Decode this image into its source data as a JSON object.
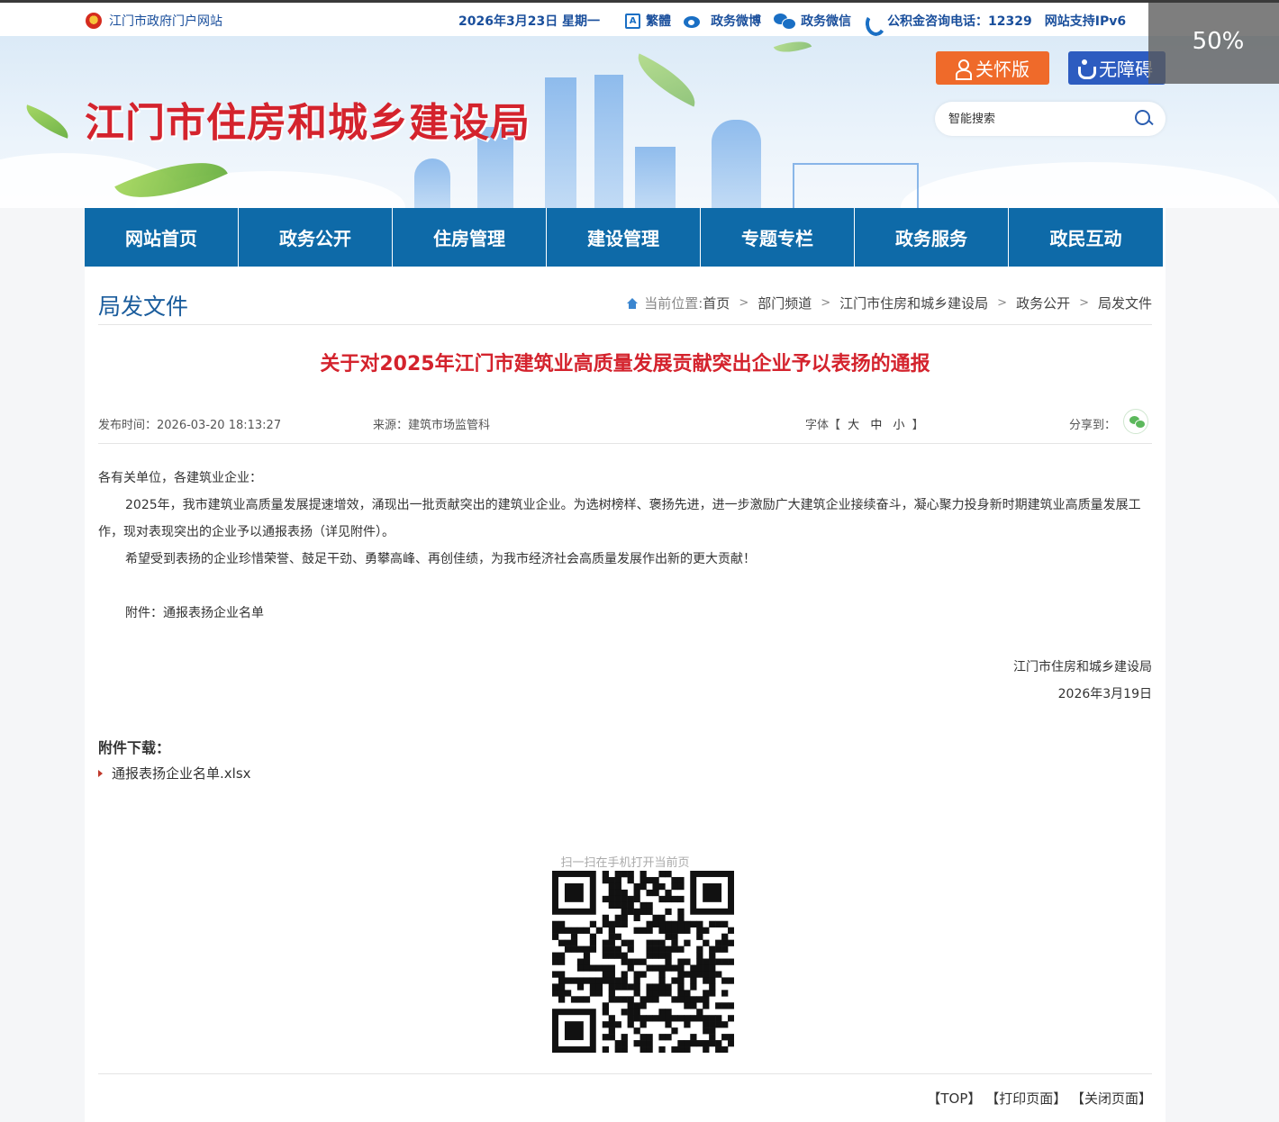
{
  "topbar": {
    "site_link": "江门市政府门户网站",
    "date": "2026年3月23日 星期一",
    "traditional": "繁體",
    "weibo": "政务微博",
    "wechat": "政务微信",
    "hotline": "公积金咨询电话：12329",
    "ipv6": "网站支持IPv6"
  },
  "zoom_level": "50%",
  "header": {
    "site_title": "江门市住房和城乡建设局",
    "care_button": "关怀版",
    "accessibility_button": "无障碍",
    "search_placeholder": "智能搜索"
  },
  "nav": {
    "items": [
      "网站首页",
      "政务公开",
      "住房管理",
      "建设管理",
      "专题专栏",
      "政务服务",
      "政民互动"
    ]
  },
  "column_title": "局发文件",
  "breadcrumb": {
    "label": "当前位置:",
    "items": [
      "首页",
      "部门频道",
      "江门市住房和城乡建设局",
      "政务公开",
      "局发文件"
    ]
  },
  "article": {
    "title": "关于对2025年江门市建筑业高质量发展贡献突出企业予以表扬的通报",
    "publish_label": "发布时间：",
    "publish_time": "2026-03-20 18:13:27",
    "source_label": "来源：",
    "source": "建筑市场监管科",
    "font_label": "字体【",
    "font_large": "大",
    "font_medium": "中",
    "font_small": "小",
    "font_close": "】",
    "share_label": "分享到：",
    "salutation": "各有关单位，各建筑业企业：",
    "paragraph1": "2025年，我市建筑业高质量发展提速增效，涌现出一批贡献突出的建筑业企业。为选树榜样、褒扬先进，进一步激励广大建筑企业接续奋斗，凝心聚力投身新时期建筑业高质量发展工作，现对表现突出的企业予以通报表扬（详见附件）。",
    "paragraph2": "希望受到表扬的企业珍惜荣誉、鼓足干劲、勇攀高峰、再创佳绩，为我市经济社会高质量发展作出新的更大贡献！",
    "attachment_note": "附件：通报表扬企业名单",
    "signature": "江门市住房和城乡建设局",
    "sign_date": "2026年3月19日"
  },
  "attachments": {
    "title": "附件下载：",
    "files": [
      "通报表扬企业名单.xlsx"
    ]
  },
  "qr": {
    "caption": "扫一扫在手机打开当前页"
  },
  "footer_links": {
    "top": "【TOP】",
    "print": "【打印页面】",
    "close": "【关闭页面】"
  }
}
